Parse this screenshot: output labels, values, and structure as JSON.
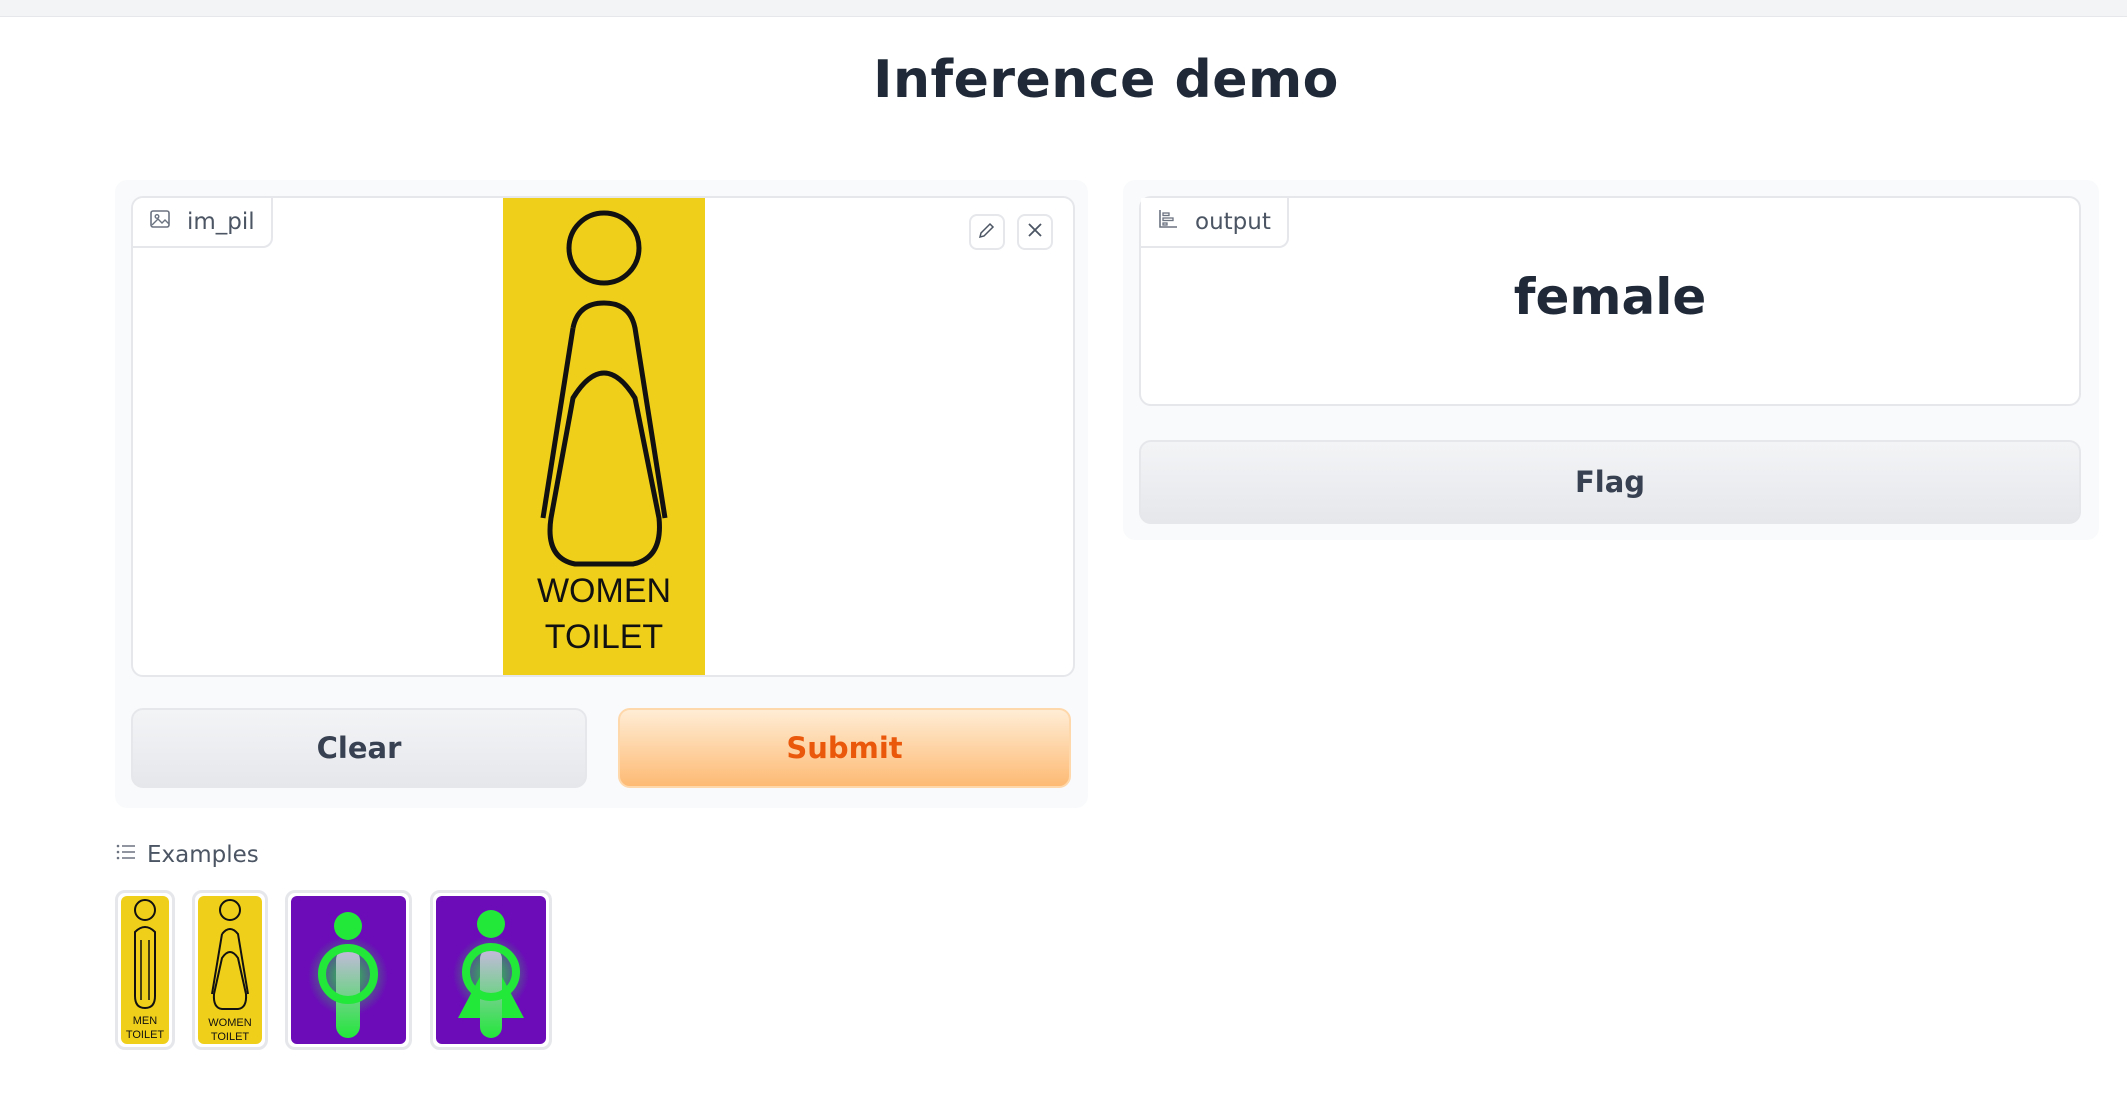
{
  "header": {
    "title": "Inference demo"
  },
  "input": {
    "label": "im_pil",
    "image_icon": "image-icon",
    "edit_icon": "pencil-icon",
    "close_icon": "close-icon",
    "image_text": [
      "WOMEN",
      "TOILET"
    ],
    "image_background": "#f0cf1b"
  },
  "actions": {
    "clear_label": "Clear",
    "submit_label": "Submit"
  },
  "output": {
    "label": "output",
    "label_icon": "bar-chart-icon",
    "value": "female",
    "flag_label": "Flag"
  },
  "examples": {
    "label": "Examples",
    "icon": "list-icon",
    "items": [
      {
        "caption": [
          "MEN",
          "TOILET"
        ]
      },
      {
        "caption": [
          "WOMEN",
          "TOILET"
        ]
      },
      {
        "caption": []
      },
      {
        "caption": []
      }
    ]
  },
  "colors": {
    "accent": "#ea580c",
    "sign_yellow": "#f0cf1b",
    "sign_purple": "#6b0cb8",
    "sign_green": "#22e83a"
  }
}
